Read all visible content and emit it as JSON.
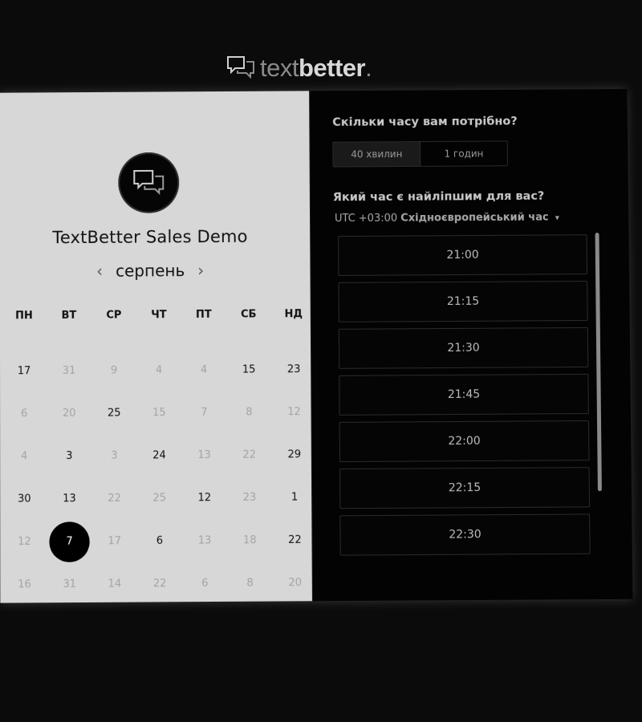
{
  "logo": {
    "light": "text",
    "bold": "better",
    "dot": "."
  },
  "product": {
    "title": "TextBetter Sales Demo"
  },
  "calendar": {
    "month": "серпень",
    "weekdays": [
      "ПН",
      "ВТ",
      "СР",
      "ЧТ",
      "ПТ",
      "СБ",
      "НД"
    ],
    "days": [
      {
        "label": "17",
        "available": true
      },
      {
        "label": "31",
        "available": false
      },
      {
        "label": "9",
        "available": false
      },
      {
        "label": "4",
        "available": false
      },
      {
        "label": "4",
        "available": false
      },
      {
        "label": "15",
        "available": true
      },
      {
        "label": "23",
        "available": true
      },
      {
        "label": "6",
        "available": false
      },
      {
        "label": "20",
        "available": false
      },
      {
        "label": "25",
        "available": true
      },
      {
        "label": "15",
        "available": false
      },
      {
        "label": "7",
        "available": false
      },
      {
        "label": "8",
        "available": false
      },
      {
        "label": "12",
        "available": false
      },
      {
        "label": "4",
        "available": false
      },
      {
        "label": "3",
        "available": true
      },
      {
        "label": "3",
        "available": false
      },
      {
        "label": "24",
        "available": true
      },
      {
        "label": "13",
        "available": false
      },
      {
        "label": "22",
        "available": false
      },
      {
        "label": "29",
        "available": true
      },
      {
        "label": "30",
        "available": true
      },
      {
        "label": "13",
        "available": true
      },
      {
        "label": "22",
        "available": false
      },
      {
        "label": "25",
        "available": false
      },
      {
        "label": "12",
        "available": true
      },
      {
        "label": "23",
        "available": false
      },
      {
        "label": "1",
        "available": true
      },
      {
        "label": "12",
        "available": false
      },
      {
        "label": "7",
        "available": true,
        "selected": true
      },
      {
        "label": "17",
        "available": false
      },
      {
        "label": "6",
        "available": true
      },
      {
        "label": "13",
        "available": false
      },
      {
        "label": "18",
        "available": false
      },
      {
        "label": "22",
        "available": true
      },
      {
        "label": "16",
        "available": false
      },
      {
        "label": "31",
        "available": false
      },
      {
        "label": "14",
        "available": false
      },
      {
        "label": "22",
        "available": false
      },
      {
        "label": "6",
        "available": false
      },
      {
        "label": "8",
        "available": false
      },
      {
        "label": "20",
        "available": false
      }
    ]
  },
  "booking": {
    "duration_question": "Скільки часу вам потрібно?",
    "durations": [
      "40 хвилин",
      "1 годин"
    ],
    "selected_duration": "40 хвилин",
    "time_question": "Який час є найліпшим для вас?",
    "timezone_offset": "UTC +03:00",
    "timezone_name": "Східноєвропейський час",
    "slots": [
      "21:00",
      "21:15",
      "21:30",
      "21:45",
      "22:00",
      "22:15",
      "22:30",
      ""
    ]
  }
}
